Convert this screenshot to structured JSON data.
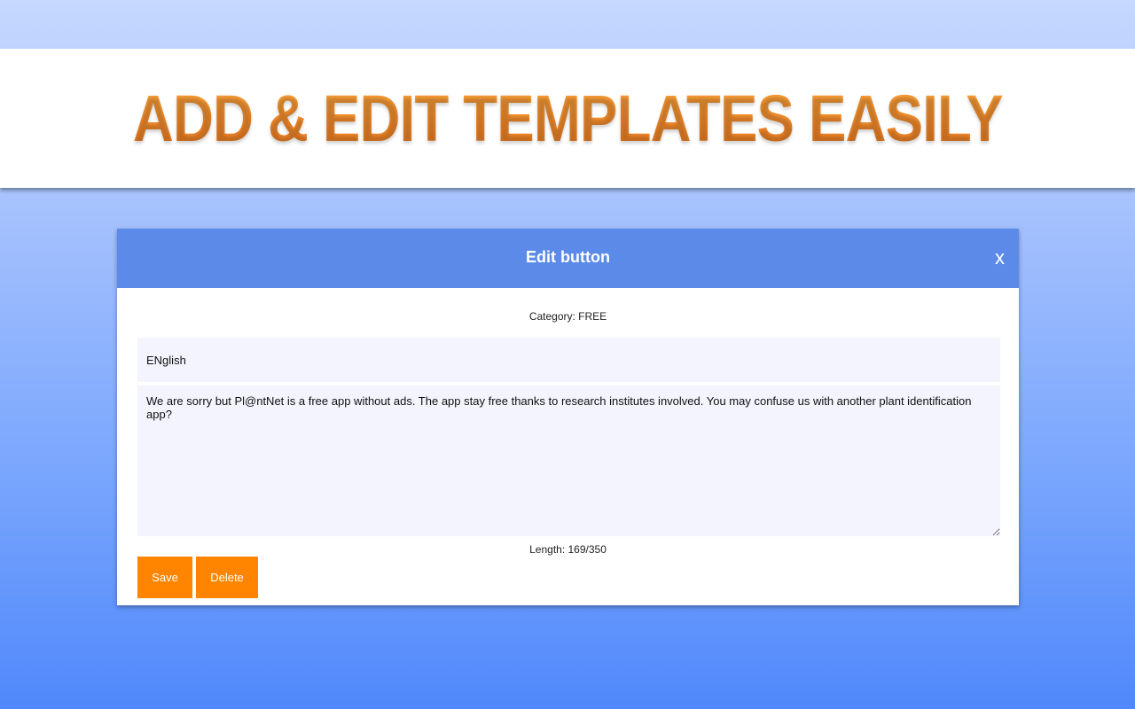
{
  "banner": {
    "title": "ADD & EDIT TEMPLATES EASILY"
  },
  "modal": {
    "title": "Edit button",
    "close_label": "x",
    "category": "Category: FREE",
    "name_value": "ENglish",
    "message_value": "We are sorry but Pl@ntNet is a free app without ads. The app stay free thanks to research institutes involved. You may confuse us with another plant identification app?",
    "length": "Length: 169/350",
    "save_label": "Save",
    "delete_label": "Delete"
  },
  "colors": {
    "header": "#5b8ae8",
    "button": "#ff8400",
    "banner_text": "#f58c2c",
    "field_background": "#f3f4fd"
  }
}
